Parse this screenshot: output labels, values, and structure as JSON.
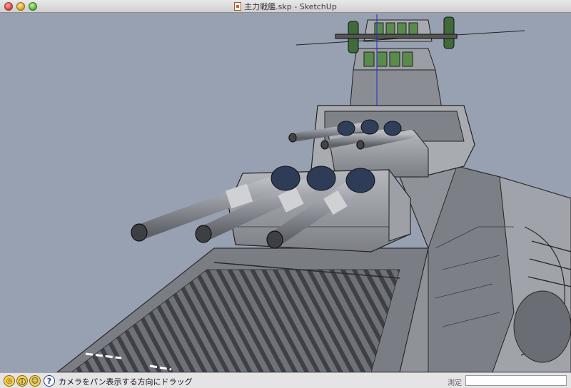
{
  "window": {
    "title": "主力戦艦.skp - SketchUp",
    "file_icon": "sketchup-file-icon"
  },
  "status": {
    "message": "カメラをパン表示する方向にドラッグ",
    "measure_label": "測定",
    "measure_value": "",
    "buttons": [
      "geo-location-icon",
      "credits-icon",
      "user-icon",
      "help-icon"
    ]
  },
  "model": {
    "subject": "3D battleship model in SketchUp viewport",
    "background_color": "#98a1b1",
    "hull_color": "#8f9298"
  }
}
